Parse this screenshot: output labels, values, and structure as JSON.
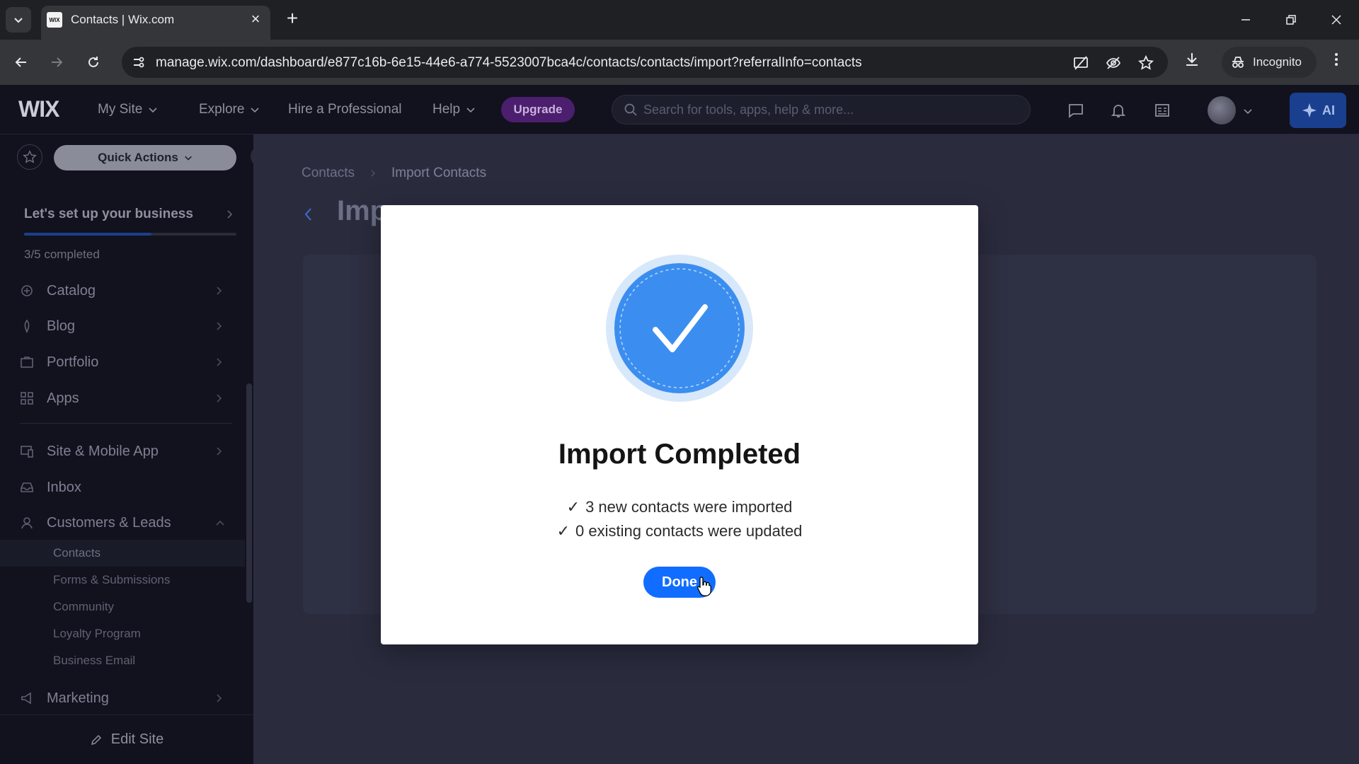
{
  "browser": {
    "tab_title": "Contacts | Wix.com",
    "favicon_text": "WIX",
    "url": "manage.wix.com/dashboard/e877c16b-6e15-44e6-a774-5523007bca4c/contacts/contacts/import?referralInfo=contacts",
    "incognito_label": "Incognito"
  },
  "wix_bar": {
    "logo": "WIX",
    "nav": [
      {
        "label": "My Site",
        "has_dropdown": true
      },
      {
        "label": "Explore",
        "has_dropdown": true
      },
      {
        "label": "Hire a Professional",
        "has_dropdown": false
      },
      {
        "label": "Help",
        "has_dropdown": true
      }
    ],
    "upgrade_label": "Upgrade",
    "search_placeholder": "Search for tools, apps, help & more...",
    "ai_label": "AI"
  },
  "sidebar": {
    "quick_actions_label": "Quick Actions",
    "setup": {
      "title": "Let's set up your business",
      "status": "3/5 completed",
      "progress": 0.6
    },
    "items": [
      {
        "label": "Catalog",
        "icon": "catalog-icon"
      },
      {
        "label": "Blog",
        "icon": "blog-icon"
      },
      {
        "label": "Portfolio",
        "icon": "portfolio-icon"
      },
      {
        "label": "Apps",
        "icon": "apps-icon"
      },
      {
        "label": "Site & Mobile App",
        "icon": "site-mobile-icon"
      },
      {
        "label": "Inbox",
        "icon": "inbox-icon"
      },
      {
        "label": "Customers & Leads",
        "icon": "customers-icon",
        "expanded": true
      },
      {
        "label": "Marketing",
        "icon": "marketing-icon"
      }
    ],
    "subitems": [
      {
        "label": "Contacts",
        "active": true
      },
      {
        "label": "Forms & Submissions"
      },
      {
        "label": "Community"
      },
      {
        "label": "Loyalty Program"
      },
      {
        "label": "Business Email"
      }
    ],
    "edit_site_label": "Edit Site"
  },
  "main": {
    "breadcrumb": [
      "Contacts",
      "Import Contacts"
    ],
    "page_title": "Imp"
  },
  "modal": {
    "title": "Import Completed",
    "results": [
      "3 new contacts were imported",
      "0 existing contacts were updated"
    ],
    "check_glyph": "✓",
    "done_label": "Done"
  },
  "colors": {
    "accent_blue": "#116dff",
    "upgrade_purple": "#4b1e6e",
    "success_badge": "#3b8ef0"
  }
}
